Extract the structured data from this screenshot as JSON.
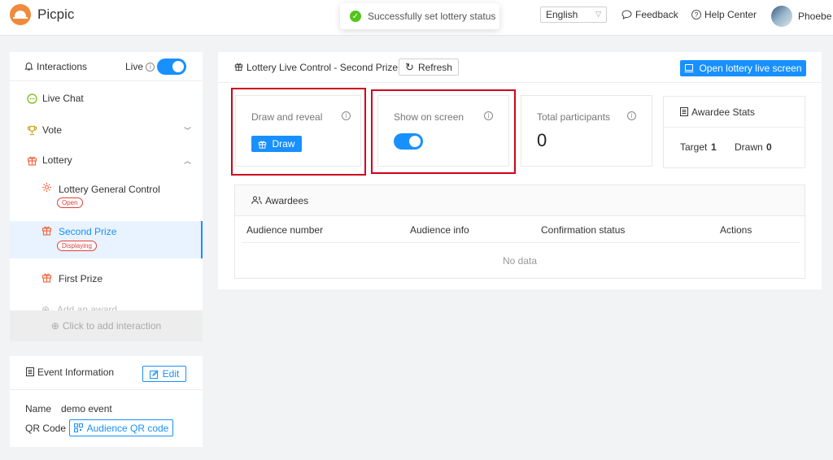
{
  "app": {
    "name": "Picpic"
  },
  "toast": {
    "message": "Successfully set lottery status"
  },
  "header": {
    "language": "English",
    "feedback": "Feedback",
    "help_center": "Help Center",
    "user_name": "Phoebe"
  },
  "sidebar": {
    "title": "Interactions",
    "live_label": "Live",
    "live_on": true,
    "items": [
      {
        "label": "Live Chat"
      },
      {
        "label": "Vote"
      },
      {
        "label": "Lottery"
      }
    ],
    "sub_items": [
      {
        "label": "Lottery General Control",
        "badge": "Open"
      },
      {
        "label": "Second Prize",
        "badge": "Displaying"
      },
      {
        "label": "First Prize"
      },
      {
        "label": "Add an award"
      }
    ],
    "add_interaction": "Click to add interaction"
  },
  "event": {
    "title": "Event Information",
    "edit_label": "Edit",
    "name_label": "Name",
    "name_value": "demo event",
    "qr_label": "QR Code",
    "qr_button": "Audience QR code"
  },
  "main": {
    "title": "Lottery Live Control - Second Prize",
    "refresh_label": "Refresh",
    "open_screen_label": "Open lottery live screen",
    "draw_card": {
      "label": "Draw and reveal",
      "button": "Draw"
    },
    "show_card": {
      "label": "Show on screen",
      "on": true
    },
    "participants_card": {
      "label": "Total participants",
      "value": "0"
    },
    "stats": {
      "title": "Awardee Stats",
      "target_label": "Target",
      "target_value": "1",
      "drawn_label": "Drawn",
      "drawn_value": "0"
    },
    "awardees": {
      "title": "Awardees",
      "columns": [
        "Audience number",
        "Audience info",
        "Confirmation status",
        "Actions"
      ],
      "empty_text": "No data"
    }
  },
  "colors": {
    "accent": "#1890ff",
    "highlight": "#d0021b",
    "success": "#52c41a",
    "badge": "#e0403a"
  }
}
